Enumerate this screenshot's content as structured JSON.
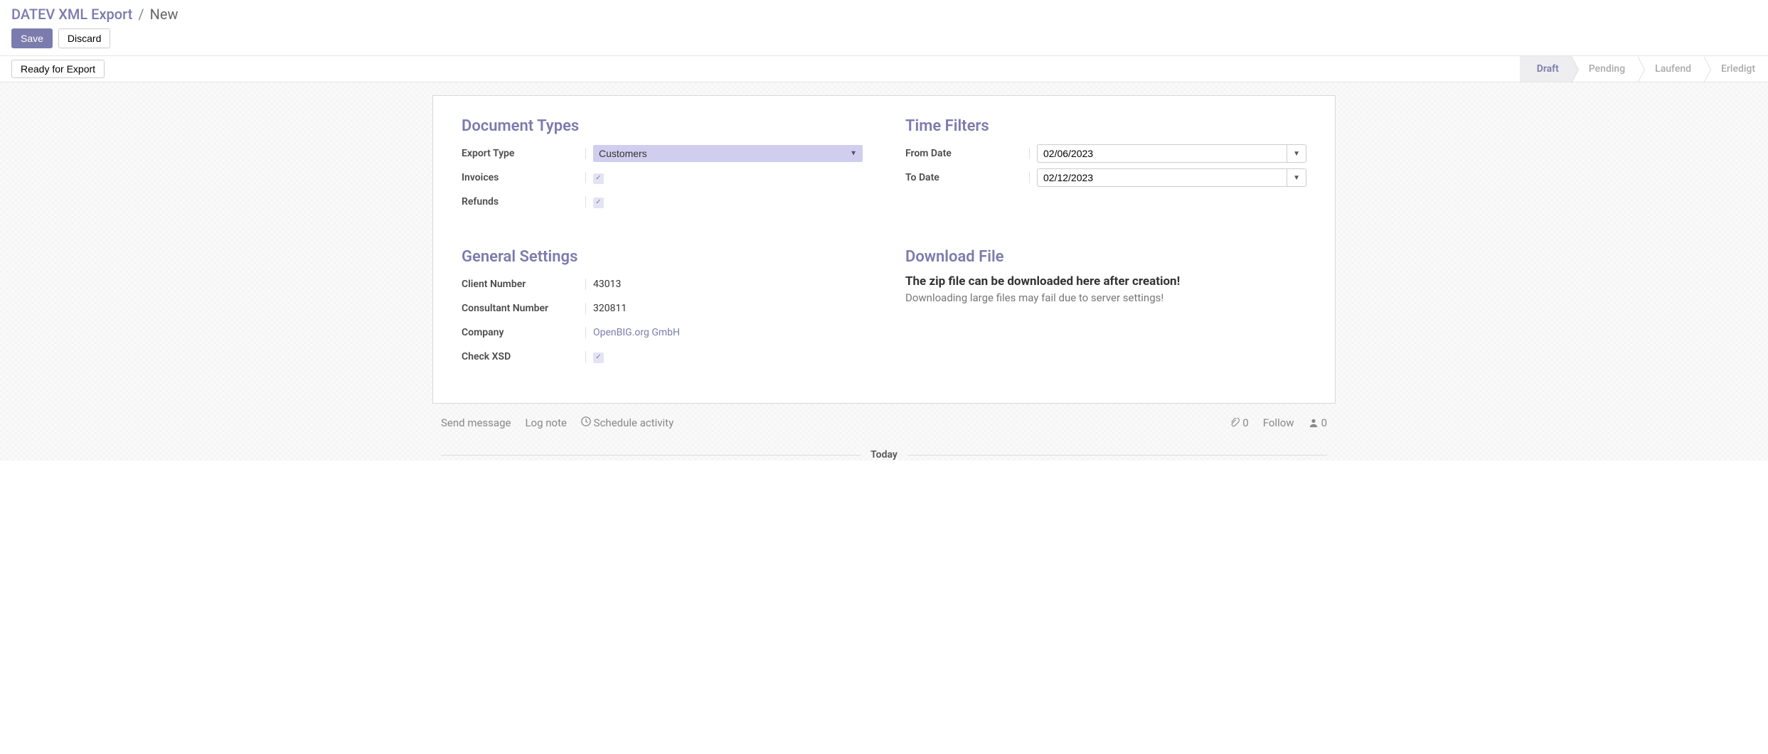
{
  "breadcrumb": {
    "root": "DATEV XML Export",
    "separator": "/",
    "current": "New"
  },
  "buttons": {
    "save": "Save",
    "discard": "Discard",
    "ready": "Ready for Export"
  },
  "statusbar": {
    "draft": "Draft",
    "pending": "Pending",
    "laufend": "Laufend",
    "erledigt": "Erledigt"
  },
  "sections": {
    "document_types": {
      "title": "Document Types",
      "export_type_label": "Export Type",
      "export_type_value": "Customers",
      "invoices_label": "Invoices",
      "refunds_label": "Refunds"
    },
    "time_filters": {
      "title": "Time Filters",
      "from_label": "From Date",
      "from_value": "02/06/2023",
      "to_label": "To Date",
      "to_value": "02/12/2023"
    },
    "general_settings": {
      "title": "General Settings",
      "client_number_label": "Client Number",
      "client_number_value": "43013",
      "consultant_number_label": "Consultant Number",
      "consultant_number_value": "320811",
      "company_label": "Company",
      "company_value": "OpenBIG.org GmbH",
      "check_xsd_label": "Check XSD"
    },
    "download": {
      "title": "Download File",
      "heading": "The zip file can be downloaded here after creation!",
      "note": "Downloading large files may fail due to server settings!"
    }
  },
  "chatter": {
    "send_message": "Send message",
    "log_note": "Log note",
    "schedule_activity": "Schedule activity",
    "attachments": "0",
    "follow": "Follow",
    "followers": "0",
    "today": "Today"
  }
}
